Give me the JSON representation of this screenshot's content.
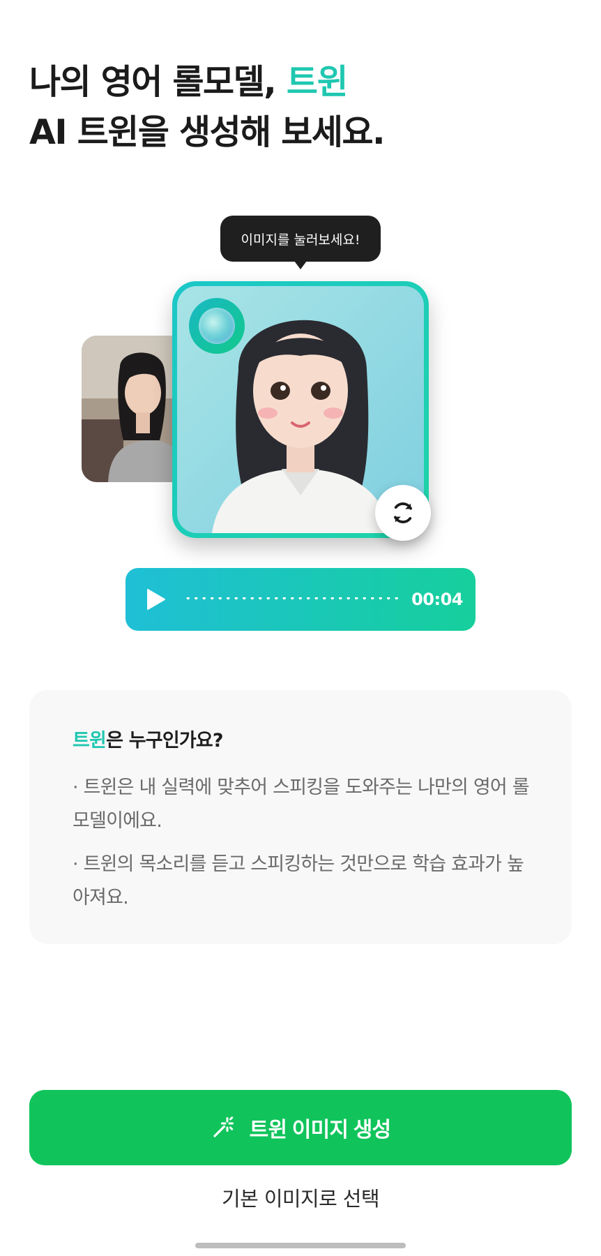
{
  "headline": {
    "line1_prefix": "나의 영어 롤모델, ",
    "line1_accent": "트윈",
    "line2": "AI 트윈을 생성해 보세요."
  },
  "tooltip": {
    "text": "이미지를 눌러보세요!"
  },
  "audio": {
    "time": "00:04"
  },
  "info": {
    "title_accent": "트윈",
    "title_rest": "은 누구인가요?",
    "bullets": [
      "· 트윈은 내 실력에 맞추어 스피킹을 도와주는 나만의 영어 롤모델이에요.",
      "· 트윈의 목소리를 듣고 스피킹하는 것만으로 학습 효과가 높아져요."
    ]
  },
  "actions": {
    "generate_label": "트윈 이미지 생성",
    "default_label": "기본 이미지로 선택"
  },
  "icons": {
    "refresh": "refresh-icon",
    "play": "play-icon",
    "wand": "magic-wand-icon"
  },
  "colors": {
    "accent": "#1fc7b0",
    "primary_button": "#10c45b",
    "audio_gradient_start": "#1fbfd6",
    "audio_gradient_end": "#16cf9c"
  }
}
